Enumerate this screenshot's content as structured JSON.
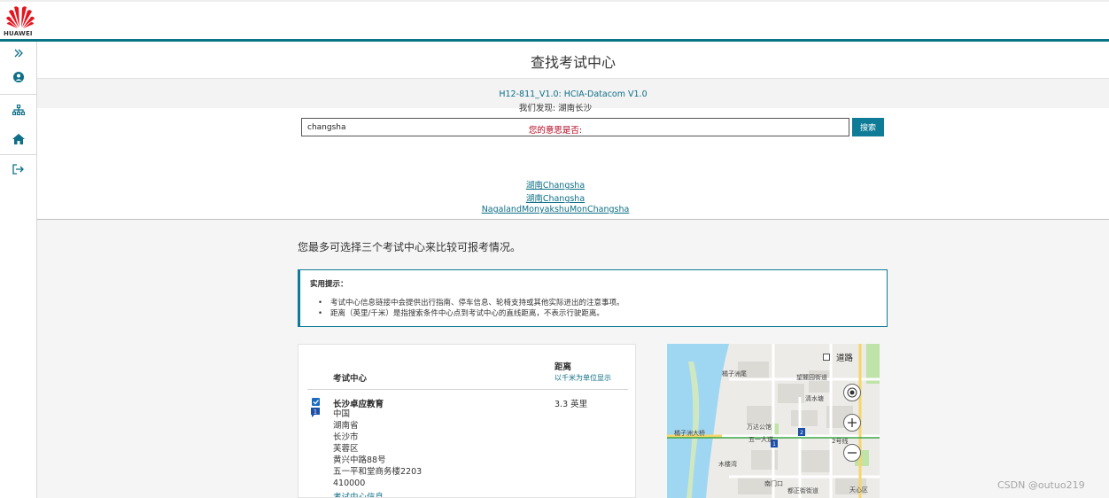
{
  "brand": {
    "name": "HUAWEI",
    "color": "#e5151f"
  },
  "colors": {
    "accent": "#0e7c96",
    "link": "#0e6f87",
    "warning": "#b3001b"
  },
  "rail": {
    "items": [
      {
        "icon": "expand-icon"
      },
      {
        "icon": "user-icon"
      },
      {
        "icon": "sitemap-icon"
      },
      {
        "icon": "home-icon"
      },
      {
        "icon": "logout-icon"
      }
    ]
  },
  "page": {
    "title": "查找考试中心",
    "exam": "H12-811_V1.0: HCIA-Datacom V1.0"
  },
  "search": {
    "value": "changsha",
    "button_label": "搜索",
    "found_text": "我们发现: 湖南长沙",
    "did_you_mean": "您的意思是否:",
    "suggestions": [
      "湖南Changsha",
      "湖南Changsha",
      "NagalandMonyakshuMonChangsha"
    ]
  },
  "compare": {
    "text": "您最多可选择三个考试中心来比较可报考情况。"
  },
  "tips": {
    "title": "实用提示：",
    "items": [
      "考试中心信息链接中会提供出行指南、停车信息、轮椅支持或其他实际进出的注意事项。",
      "距离（英里/千米）是指搜索条件中心点到考试中心的直线距离，不表示行驶距离。"
    ]
  },
  "results": {
    "col_center": "考试中心",
    "col_distance": "距离",
    "col_distance_unit": "以千米为单位显示",
    "rows": [
      {
        "checked": true,
        "marker": "1",
        "name": "长沙卓应教育",
        "address": [
          "中国",
          "湖南省",
          "长沙市",
          "芙蓉区",
          "黄兴中路88号",
          "五一平和堂商务楼2203",
          "410000"
        ],
        "link": "考试中心信息",
        "distance": "3.3 英里"
      }
    ]
  },
  "map": {
    "toggle_label": "道路",
    "labels": [
      "橘子洲尾",
      "望麓园街道",
      "清水塘",
      "万达公馆",
      "五一大道",
      "橘子洲大桥",
      "2号线",
      "木楼湾",
      "南门口",
      "都正街街道",
      "天心区"
    ],
    "markers": [
      "1",
      "2"
    ],
    "water_color": "#9fd6f2",
    "park_color": "#bfe3a9"
  },
  "watermark": "CSDN @outuo219"
}
